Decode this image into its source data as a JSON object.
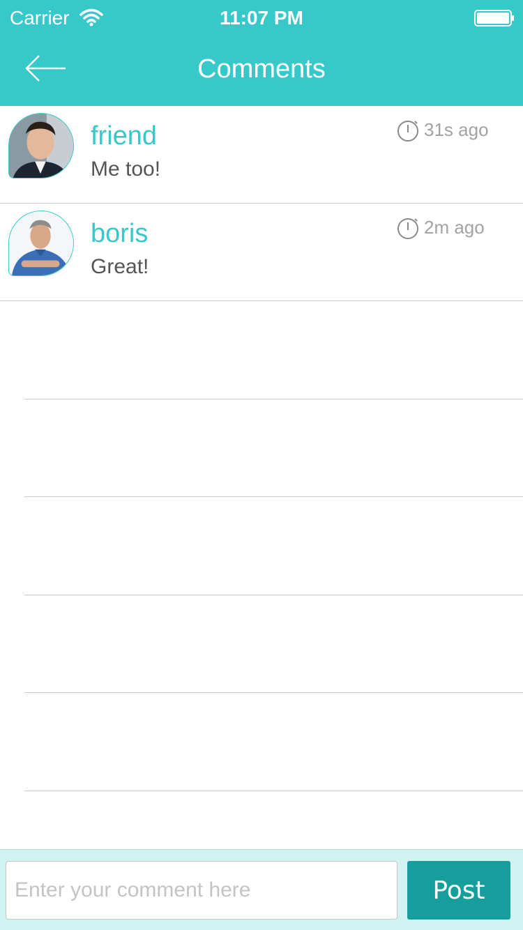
{
  "status_bar": {
    "carrier": "Carrier",
    "time": "11:07 PM"
  },
  "nav": {
    "title": "Comments",
    "back_icon": "arrow-left-icon"
  },
  "comments": [
    {
      "username": "friend",
      "text": "Me too!",
      "time": "31s ago"
    },
    {
      "username": "boris",
      "text": "Great!",
      "time": "2m ago"
    }
  ],
  "composer": {
    "placeholder": "Enter your comment here",
    "value": "",
    "post_label": "Post"
  },
  "colors": {
    "accent": "#37c8ca",
    "post_button": "#159e9c",
    "footer_bg": "#d2f1f1",
    "muted_text": "#a3a3a3",
    "body_text": "#555555"
  }
}
